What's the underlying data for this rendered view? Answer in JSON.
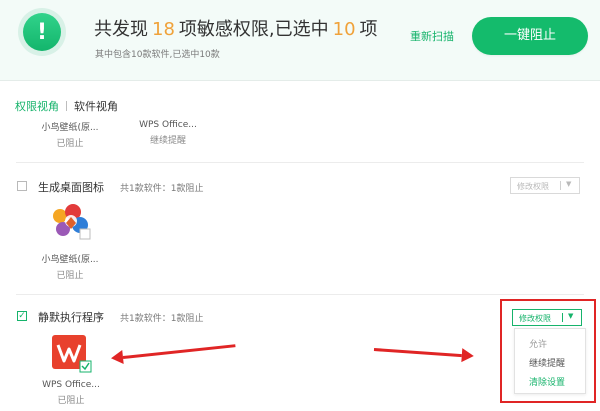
{
  "header": {
    "headline": {
      "pre": "共发现",
      "found": "18",
      "mid": "项敏感权限,已选中",
      "selected": "10",
      "post": "项"
    },
    "subline": "其中包含10款软件,已选中10款",
    "rescan": "重新扫描",
    "block_all": "一键阻止"
  },
  "tabs": {
    "permission_view": "权限视角",
    "software_view": "软件视角"
  },
  "top_apps": [
    {
      "name": "小鸟壁纸(原...",
      "status": "已阻止"
    },
    {
      "name": "WPS Office...",
      "status": "继续提醒"
    }
  ],
  "sections": [
    {
      "title": "生成桌面图标",
      "count": "共1款软件：1款阻止",
      "dropdown_label": "修改权限",
      "apps": [
        {
          "name": "小鸟壁纸(原...",
          "status": "已阻止"
        }
      ]
    },
    {
      "title": "静默执行程序",
      "count": "共1款软件：1款阻止",
      "dropdown_label": "修改权限",
      "apps": [
        {
          "name": "WPS Office...",
          "status": "已阻止"
        }
      ]
    }
  ],
  "dropdown_menu": {
    "options": [
      "允许",
      "继续提醒",
      "清除设置"
    ]
  },
  "colors": {
    "accent": "#14bb6c",
    "highlight_num": "#f0a23a",
    "annotation": "#e02525"
  }
}
